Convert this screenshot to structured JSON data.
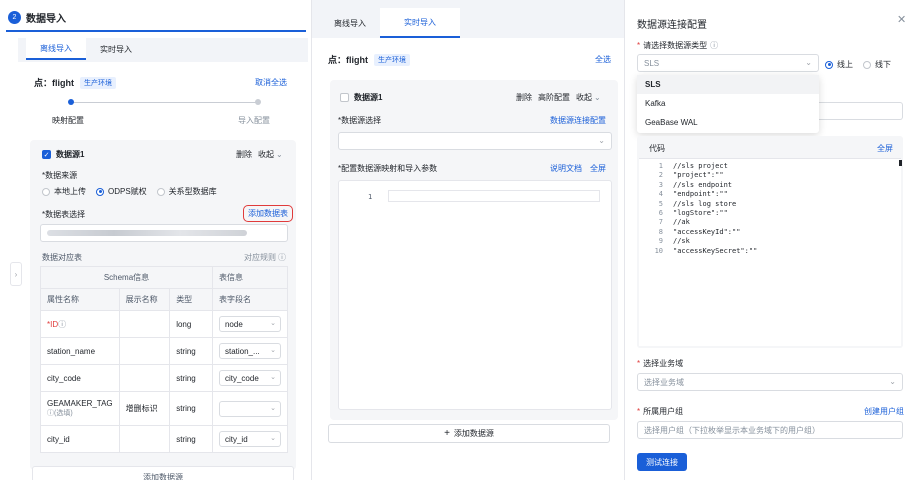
{
  "left": {
    "step_num": "2",
    "step_title": "数据导入",
    "tabs": [
      "离线导入",
      "实时导入"
    ],
    "point_label": "点：flight",
    "env_tag": "生产环境",
    "cancel_all": "取消全选",
    "steps": [
      "映射配置",
      "导入配置"
    ],
    "source_name": "数据源1",
    "delete": "删除",
    "collapse": "收起",
    "data_source_label": "*数据来源",
    "radios": [
      "本地上传",
      "ODPS赋权",
      "关系型数据库"
    ],
    "table_select_label": "*数据表选择",
    "add_table": "添加数据表",
    "mapping_label": "数据对应表",
    "mapping_rule": "对应规则",
    "schema_header": "Schema信息",
    "table_info_header": "表信息",
    "columns": [
      "属性名称",
      "展示名称",
      "类型",
      "表字段名"
    ],
    "rows": [
      {
        "name": "*ID",
        "display": "",
        "type": "long",
        "field": "node"
      },
      {
        "name": "station_name",
        "display": "",
        "type": "string",
        "field": "station_..."
      },
      {
        "name": "city_code",
        "display": "",
        "type": "string",
        "field": "city_code"
      },
      {
        "name": "GEAMAKER_TAG",
        "sub": "(选填)",
        "display": "增删标识",
        "type": "string",
        "field": ""
      },
      {
        "name": "city_id",
        "display": "",
        "type": "string",
        "field": "city_id"
      }
    ],
    "bottom_add": "添加数据源"
  },
  "middle": {
    "tabs": [
      "离线导入",
      "实时导入"
    ],
    "point_label": "点：flight",
    "env_tag": "生产环境",
    "select_all": "全选",
    "source_name": "数据源1",
    "delete": "删除",
    "advanced": "高阶配置",
    "collapse": "收起",
    "ds_select_label": "*数据源选择",
    "ds_config_link": "数据源连接配置",
    "mapping_params_label": "*配置数据源映射和导入参数",
    "doc_link": "说明文档",
    "fullscreen": "全屏",
    "editor_line": "1",
    "add_source": "添加数据源"
  },
  "right": {
    "title": "数据源连接配置",
    "type_label": "请选择数据源类型",
    "type_placeholder": "SLS",
    "online": "线上",
    "offline": "线下",
    "options": [
      "SLS",
      "Kafka",
      "GeaBase WAL"
    ],
    "code_label": "代码",
    "fullscreen": "全屏",
    "code_lines": [
      {
        "n": "1",
        "t": "//sls project"
      },
      {
        "n": "2",
        "t": "\"project\":\"\""
      },
      {
        "n": "3",
        "t": "//sls endpoint"
      },
      {
        "n": "4",
        "t": "\"endpoint\":\"\""
      },
      {
        "n": "5",
        "t": "//sls log store"
      },
      {
        "n": "6",
        "t": "\"logStore\":\"\""
      },
      {
        "n": "7",
        "t": "//ak"
      },
      {
        "n": "8",
        "t": "\"accessKeyId\":\"\""
      },
      {
        "n": "9",
        "t": "//sk"
      },
      {
        "n": "10",
        "t": "\"accessKeySecret\":\"\""
      }
    ],
    "domain_label": "选择业务域",
    "domain_placeholder": "选择业务域",
    "group_label": "所属用户组",
    "create_group": "创建用户组",
    "group_placeholder": "选择用户组（下拉枚举显示本业务域下的用户组）",
    "test_button": "测试连接"
  }
}
